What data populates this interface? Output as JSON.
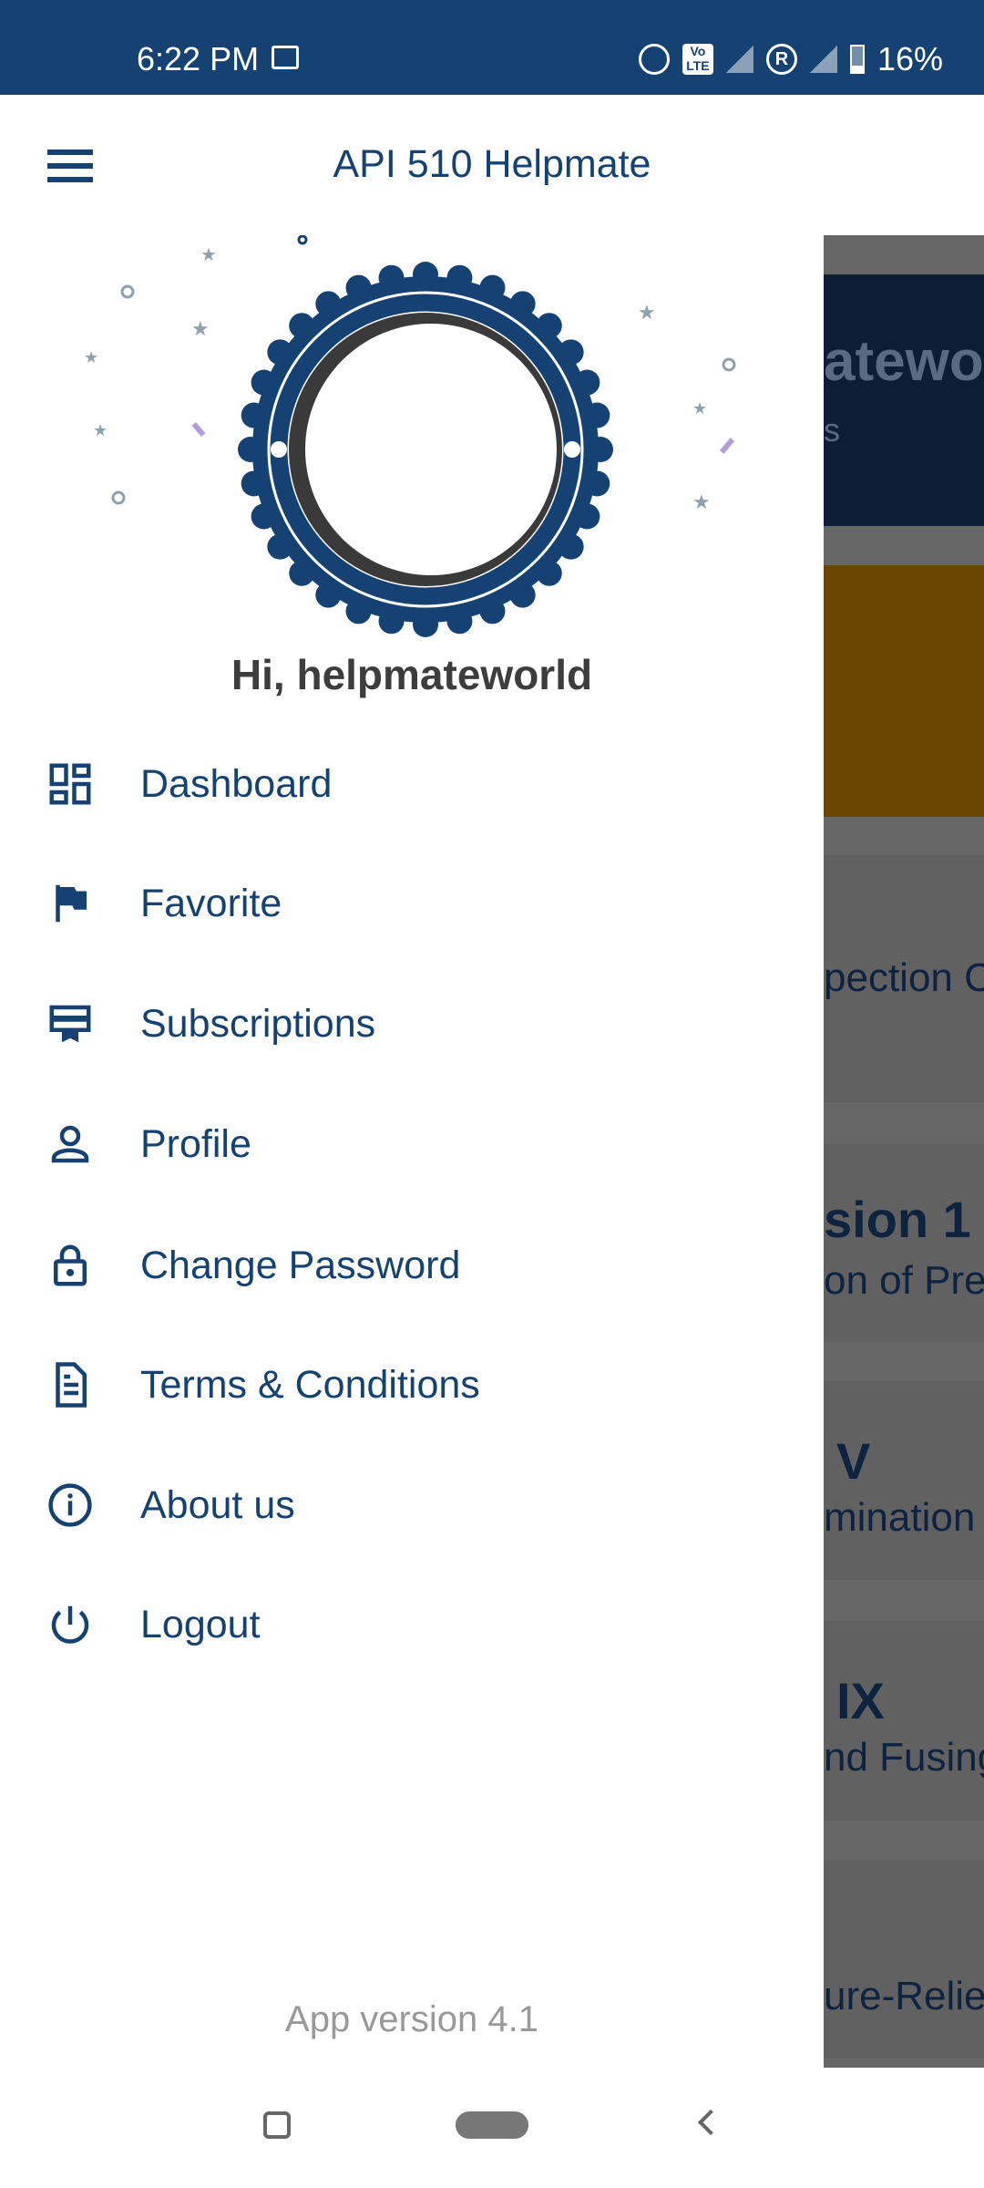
{
  "status_bar": {
    "time": "6:22 PM",
    "battery": "16%",
    "icons": [
      "outlook-icon",
      "alarm-icon",
      "volte-icon",
      "signal-5g-icon",
      "roaming-icon",
      "signal-icon",
      "battery-charging-icon"
    ]
  },
  "app_bar": {
    "title": "API 510 Helpmate",
    "menu_icon": "hamburger-icon"
  },
  "drawer": {
    "greeting": "Hi, helpmateworld",
    "items": [
      {
        "label": "Dashboard",
        "icon": "dashboard-icon"
      },
      {
        "label": "Favorite",
        "icon": "flag-icon"
      },
      {
        "label": "Subscriptions",
        "icon": "card-membership-icon"
      },
      {
        "label": "Profile",
        "icon": "person-icon"
      },
      {
        "label": "Change Password",
        "icon": "lock-icon"
      },
      {
        "label": "Terms & Conditions",
        "icon": "document-icon"
      },
      {
        "label": "About us",
        "icon": "info-icon"
      },
      {
        "label": "Logout",
        "icon": "power-icon"
      }
    ],
    "version": "App version 4.1"
  },
  "background": {
    "cards": [
      {
        "line1": "atewor",
        "line2": "s"
      },
      {
        "line1": "",
        "line2": ""
      },
      {
        "line1": "",
        "line2": "pection C"
      },
      {
        "line1": "sion 1",
        "line2": "on of Pres"
      },
      {
        "line1": "V",
        "line2": "mination"
      },
      {
        "line1": "IX",
        "line2": "nd Fusing"
      },
      {
        "line1": "",
        "line2": "ure-Reliev"
      }
    ],
    "colors": {
      "navy": "#0c1d34",
      "orange": "#6b4500",
      "scrim": "#666666"
    }
  },
  "colors": {
    "primary": "#154273"
  }
}
